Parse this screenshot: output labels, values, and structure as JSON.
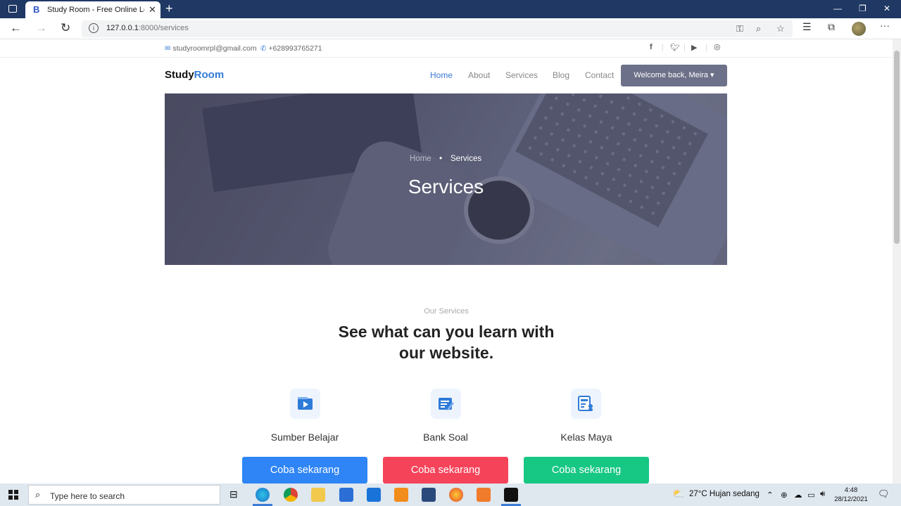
{
  "browser": {
    "tab_title": "Study Room - Free Online Learni",
    "tab_favicon": "B",
    "url_host": "127.0.0.1",
    "url_rest": ":8000/services"
  },
  "taskbar": {
    "search_placeholder": "Type here to search",
    "weather": "27°C  Hujan sedang",
    "time": "4:48",
    "date": "28/12/2021"
  },
  "topinfo": {
    "email": "studyroomrpl@gmail.com",
    "phone": "+628993765271",
    "social": [
      "facebook-icon",
      "twitter-icon",
      "youtube-icon",
      "instagram-icon"
    ]
  },
  "navbar": {
    "brand_first": "Study",
    "brand_second": "Room",
    "links": [
      "Home",
      "About",
      "Services",
      "Blog",
      "Contact"
    ],
    "active": "Home",
    "user_button": "Welcome back, Meira"
  },
  "hero": {
    "breadcrumb_home": "Home",
    "breadcrumb_sep": "•",
    "breadcrumb_current": "Services",
    "title": "Services"
  },
  "services": {
    "kicker": "Our Services",
    "title_line1": "See what can you learn with",
    "title_line2": "our website.",
    "items": [
      {
        "label": "Sumber Belajar",
        "button": "Coba sekarang",
        "color": "#2f85f5",
        "icon": "video-learning-icon"
      },
      {
        "label": "Bank Soal",
        "button": "Coba sekarang",
        "color": "#f5435a",
        "icon": "question-bank-icon"
      },
      {
        "label": "Kelas Maya",
        "button": "Coba sekarang",
        "color": "#17c784",
        "icon": "virtual-class-icon"
      }
    ]
  },
  "colors": {
    "accent": "#2f7bd8",
    "titlebar": "#1f3864",
    "user_button": "#6c7088"
  }
}
